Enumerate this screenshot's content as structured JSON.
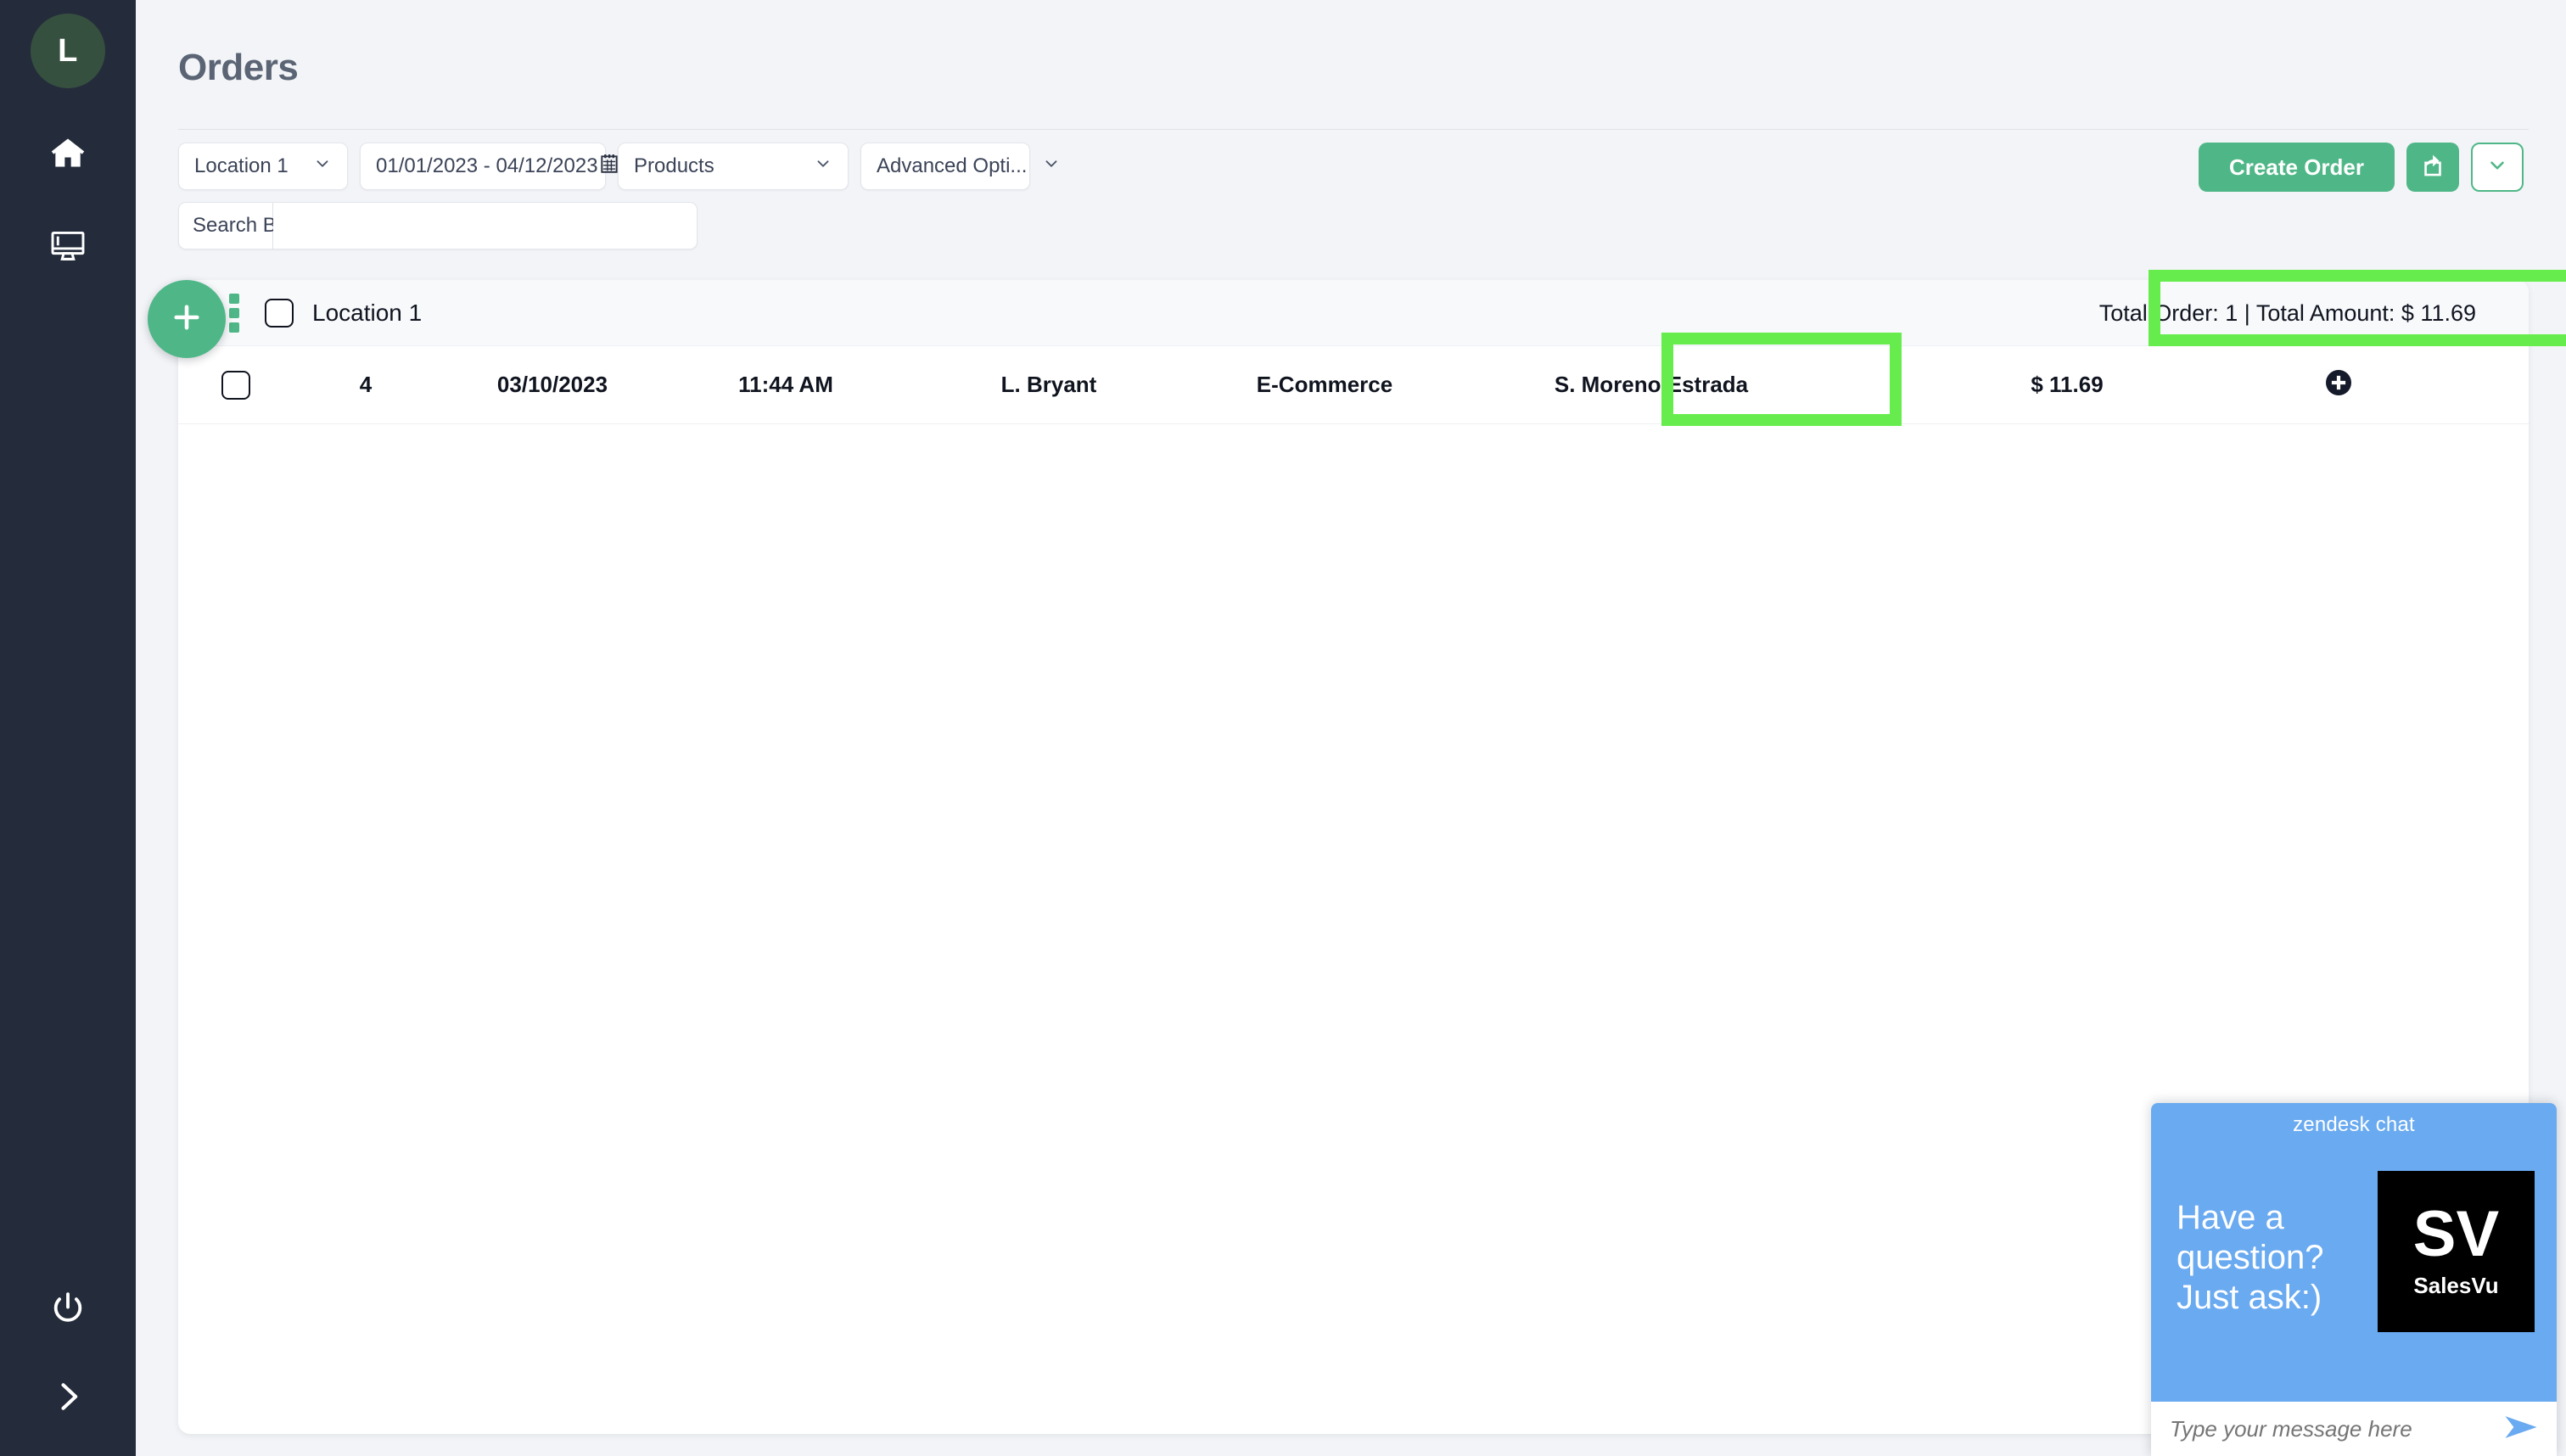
{
  "sidebar": {
    "avatar_initial": "L",
    "items": [
      {
        "name": "home-icon",
        "label": "Home"
      },
      {
        "name": "register-icon",
        "label": "Register"
      }
    ],
    "bottom_items": [
      {
        "name": "power-icon",
        "label": "Logout"
      },
      {
        "name": "chevron-right-icon",
        "label": "Expand"
      }
    ]
  },
  "header": {
    "title": "Orders"
  },
  "filters": {
    "location": {
      "value": "Location 1"
    },
    "date_range": {
      "value": "01/01/2023 - 04/12/2023"
    },
    "products": {
      "value": "Products"
    },
    "advanced_options": {
      "value": "Advanced Opti..."
    },
    "search_by": {
      "value": "Search By"
    },
    "search_input": {
      "value": "",
      "placeholder": ""
    }
  },
  "actions": {
    "create_order_label": "Create Order",
    "share_label": "Share",
    "more_label": "More"
  },
  "table": {
    "group": {
      "label": "Location 1",
      "totals": "Total Order: 1 | Total Amount: $ 11.69"
    },
    "rows": [
      {
        "number": "4",
        "date": "03/10/2023",
        "time": "11:44 AM",
        "customer": "L. Bryant",
        "channel": "E-Commerce",
        "employee": "S. Moreno Estrada",
        "amount": "$ 11.69"
      }
    ]
  },
  "chat": {
    "title": "zendesk chat",
    "prompt": "Have a question? Just ask:)",
    "logo_initials": "SV",
    "logo_brand": "SalesVu",
    "input_placeholder": "Type your message here"
  },
  "colors": {
    "sidebar_bg": "#242c3b",
    "avatar_bg": "#36503f",
    "accent_green": "#4fb787",
    "highlight_green": "#66ed4d",
    "chat_blue": "#6aaaf0",
    "page_bg": "#f2f4f7",
    "title_text": "#5a6474"
  }
}
